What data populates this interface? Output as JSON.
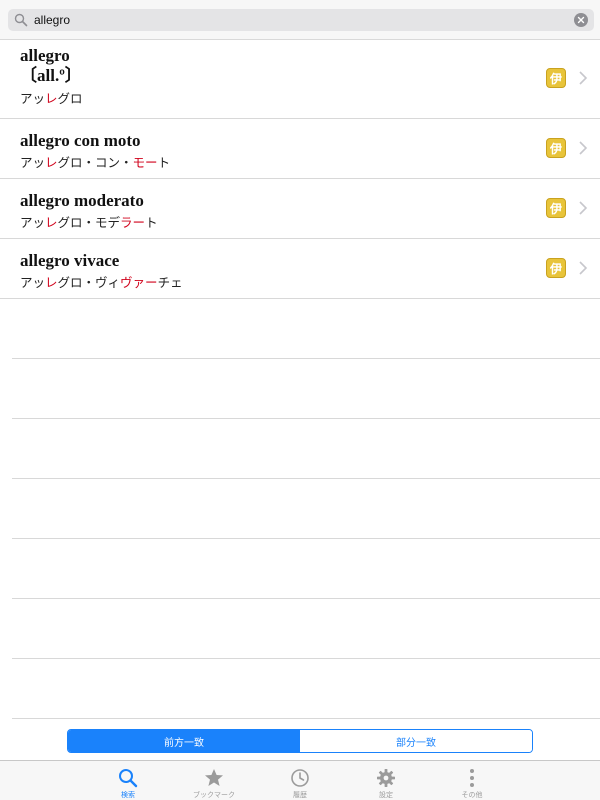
{
  "search": {
    "value": "allegro",
    "placeholder": ""
  },
  "results": [
    {
      "term": "allegro",
      "abbr": "〔all.º〕",
      "reading_parts": [
        {
          "text": "アッ",
          "hl": false
        },
        {
          "text": "レ",
          "hl": true
        },
        {
          "text": "グロ",
          "hl": false
        }
      ],
      "badge": "伊"
    },
    {
      "term": "allegro con moto",
      "reading_parts": [
        {
          "text": "アッ",
          "hl": false
        },
        {
          "text": "レ",
          "hl": true
        },
        {
          "text": "グロ・コン・",
          "hl": false
        },
        {
          "text": "モー",
          "hl": true
        },
        {
          "text": "ト",
          "hl": false
        }
      ],
      "badge": "伊"
    },
    {
      "term": "allegro moderato",
      "reading_parts": [
        {
          "text": "アッ",
          "hl": false
        },
        {
          "text": "レ",
          "hl": true
        },
        {
          "text": "グロ・モデ",
          "hl": false
        },
        {
          "text": "ラー",
          "hl": true
        },
        {
          "text": "ト",
          "hl": false
        }
      ],
      "badge": "伊"
    },
    {
      "term": "allegro vivace",
      "reading_parts": [
        {
          "text": "アッ",
          "hl": false
        },
        {
          "text": "レ",
          "hl": true
        },
        {
          "text": "グロ・ヴィ",
          "hl": false
        },
        {
          "text": "ヴァー",
          "hl": true
        },
        {
          "text": "チェ",
          "hl": false
        }
      ],
      "badge": "伊"
    }
  ],
  "segments": {
    "prefix": "前方一致",
    "partial": "部分一致",
    "selected": "prefix"
  },
  "tabs": [
    {
      "id": "search",
      "label": "検索",
      "icon": "search-icon",
      "active": true
    },
    {
      "id": "bookmark",
      "label": "ブックマーク",
      "icon": "star-icon",
      "active": false
    },
    {
      "id": "history",
      "label": "履歴",
      "icon": "clock-icon",
      "active": false
    },
    {
      "id": "settings",
      "label": "設定",
      "icon": "gear-icon",
      "active": false
    },
    {
      "id": "more",
      "label": "その他",
      "icon": "more-vertical-icon",
      "active": false
    }
  ],
  "colors": {
    "accent": "#1a82fb",
    "highlight": "#d0021b",
    "badge": "#e8c43a"
  }
}
